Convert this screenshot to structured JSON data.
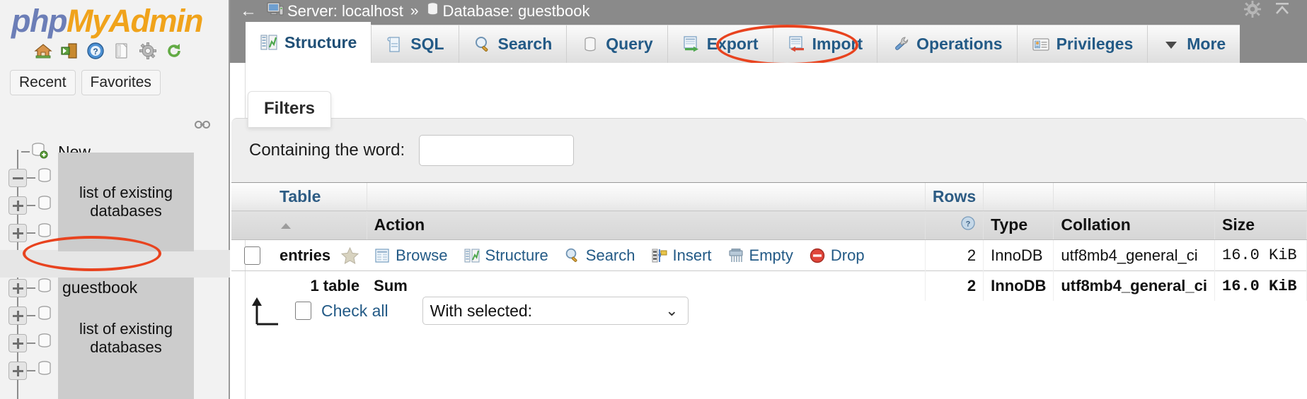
{
  "brand": {
    "php": "php",
    "myadmin": "MyAdmin"
  },
  "sidebar": {
    "nav_icons": [
      "home-icon",
      "logout-icon",
      "docs-help-icon",
      "documentation-icon",
      "settings-icon",
      "reload-icon"
    ],
    "buttons": {
      "recent": "Recent",
      "favorites": "Favorites"
    },
    "tree": {
      "new_label": "New",
      "highlighted_db": "guestbook",
      "overlay_top": "list of existing databases",
      "overlay_bottom": "list of existing databases"
    }
  },
  "topbar": {
    "back": "←",
    "server_label": "Server: localhost",
    "separator": "»",
    "database_label": "Database: guestbook",
    "right_icons": [
      "gear-icon",
      "collapse-icon"
    ]
  },
  "tabs": [
    {
      "label": "Structure",
      "icon": "structure-icon",
      "active": true,
      "highlighted": false
    },
    {
      "label": "SQL",
      "icon": "sql-icon",
      "active": false,
      "highlighted": false
    },
    {
      "label": "Search",
      "icon": "search-icon",
      "active": false,
      "highlighted": false
    },
    {
      "label": "Query",
      "icon": "query-icon",
      "active": false,
      "highlighted": false
    },
    {
      "label": "Export",
      "icon": "export-icon",
      "active": false,
      "highlighted": false
    },
    {
      "label": "Import",
      "icon": "import-icon",
      "active": false,
      "highlighted": true
    },
    {
      "label": "Operations",
      "icon": "operations-icon",
      "active": false,
      "highlighted": false
    },
    {
      "label": "Privileges",
      "icon": "privileges-icon",
      "active": false,
      "highlighted": false
    },
    {
      "label": "More",
      "icon": "chevron-down-icon",
      "active": false,
      "highlighted": false
    }
  ],
  "filters": {
    "tab_label": "Filters",
    "containing_label": "Containing the word:",
    "containing_value": "",
    "containing_placeholder": ""
  },
  "table_list": {
    "headers": {
      "table": "Table",
      "action": "Action",
      "rows": "Rows",
      "rows_help": "help-icon",
      "type": "Type",
      "collation": "Collation",
      "size": "Size"
    },
    "rows": [
      {
        "name": "entries",
        "favorite_icon": "star-icon",
        "actions": [
          {
            "label": "Browse",
            "icon": "browse-icon"
          },
          {
            "label": "Structure",
            "icon": "structure-icon"
          },
          {
            "label": "Search",
            "icon": "search-icon"
          },
          {
            "label": "Insert",
            "icon": "insert-icon"
          },
          {
            "label": "Empty",
            "icon": "empty-icon"
          },
          {
            "label": "Drop",
            "icon": "drop-icon"
          }
        ],
        "rows": "2",
        "type": "InnoDB",
        "collation": "utf8mb4_general_ci",
        "size": "16.0 KiB"
      }
    ],
    "summary": {
      "count_label": "1 table",
      "sum_label": "Sum",
      "rows": "2",
      "type": "InnoDB",
      "collation": "utf8mb4_general_ci",
      "size": "16.0 KiB"
    }
  },
  "footer": {
    "check_all": "Check all",
    "with_selected_value": "With selected:",
    "with_selected_options": [
      "With selected:"
    ]
  },
  "colors": {
    "brand_blue": "#6c7eb7",
    "brand_orange": "#f0a31b",
    "link_blue": "#235a86",
    "annotation_red": "#e8431f",
    "chrome_grey": "#8a8a8a"
  }
}
